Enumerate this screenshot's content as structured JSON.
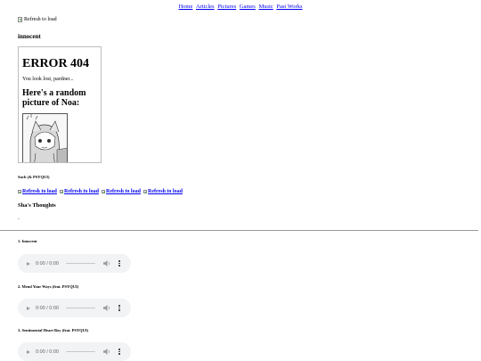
{
  "nav": {
    "items": [
      "Home",
      "Articles",
      "Pictures",
      "Games",
      "Music",
      "Past Works"
    ]
  },
  "header_image": {
    "alt": "Refresh to load"
  },
  "album": {
    "title": "innocent"
  },
  "embed": {
    "heading": "ERROR 404",
    "message": "You look lost, pardner...",
    "subheading": "Here's a random picture of Noa:"
  },
  "credit": "Such (& PSYQUI)",
  "image_links": [
    "Refresh to load",
    "Refresh to load",
    "Refresh to load",
    "Refresh to load"
  ],
  "thoughts": {
    "title": "Sha's Thoughts",
    "text": "-"
  },
  "tracks": [
    {
      "title": "1. Innocent",
      "time": "0:00 / 0:00"
    },
    {
      "title": "2. Mend Your Ways (feat. PSYQUI)",
      "time": "0:00 / 0:00"
    },
    {
      "title": "3. Sentimental Heart Boy (feat. PSYQUI)",
      "time": "0:00 / 0:00"
    }
  ],
  "icons": {
    "broken_image": "broken-image-icon",
    "play": "play-icon",
    "volume": "volume-icon",
    "more": "more-vertical-icon"
  },
  "colors": {
    "link": "#0000ee",
    "player_bg": "#f1f3f4"
  }
}
